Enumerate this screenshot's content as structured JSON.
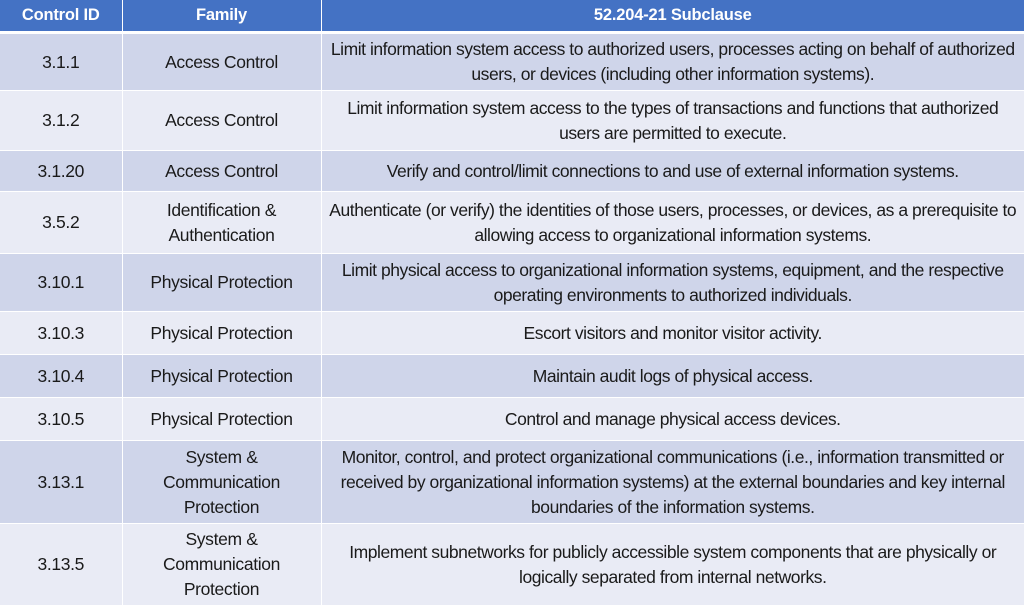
{
  "table": {
    "headers": [
      "Control ID",
      "Family",
      "52.204-21 Subclause"
    ],
    "rows": [
      {
        "id": "3.1.1",
        "family": "Access Control",
        "subclause": "Limit information system access to authorized users, processes acting on behalf of authorized users, or devices (including other information systems)."
      },
      {
        "id": "3.1.2",
        "family": "Access Control",
        "subclause": "Limit information system access to the types of transactions and functions that authorized users are permitted to execute."
      },
      {
        "id": "3.1.20",
        "family": "Access Control",
        "subclause": "Verify and control/limit connections to and use of external information systems."
      },
      {
        "id": "3.5.2",
        "family": "Identification & Authentication",
        "subclause": "Authenticate (or verify) the identities of those users, processes, or devices, as a prerequisite to allowing access to organizational information systems."
      },
      {
        "id": "3.10.1",
        "family": "Physical Protection",
        "subclause": "Limit physical access to organizational information systems, equipment, and the respective operating environments to authorized individuals."
      },
      {
        "id": "3.10.3",
        "family": "Physical Protection",
        "subclause": "Escort visitors and monitor visitor activity."
      },
      {
        "id": "3.10.4",
        "family": "Physical Protection",
        "subclause": "Maintain audit logs of physical access."
      },
      {
        "id": "3.10.5",
        "family": "Physical Protection",
        "subclause": "Control and manage physical access devices."
      },
      {
        "id": "3.13.1",
        "family": "System & Communication Protection",
        "subclause": "Monitor, control, and protect organizational communications (i.e., information transmitted or received by organizational information systems) at the external boundaries and key internal boundaries of the information systems."
      },
      {
        "id": "3.13.5",
        "family": "System & Communication Protection",
        "subclause": "Implement subnetworks for publicly accessible system components that are physically or logically separated from internal networks."
      }
    ]
  },
  "colors": {
    "header_bg": "#4472c4",
    "row_band_dark": "#cfd5ea",
    "row_band_light": "#e9ebf5"
  }
}
